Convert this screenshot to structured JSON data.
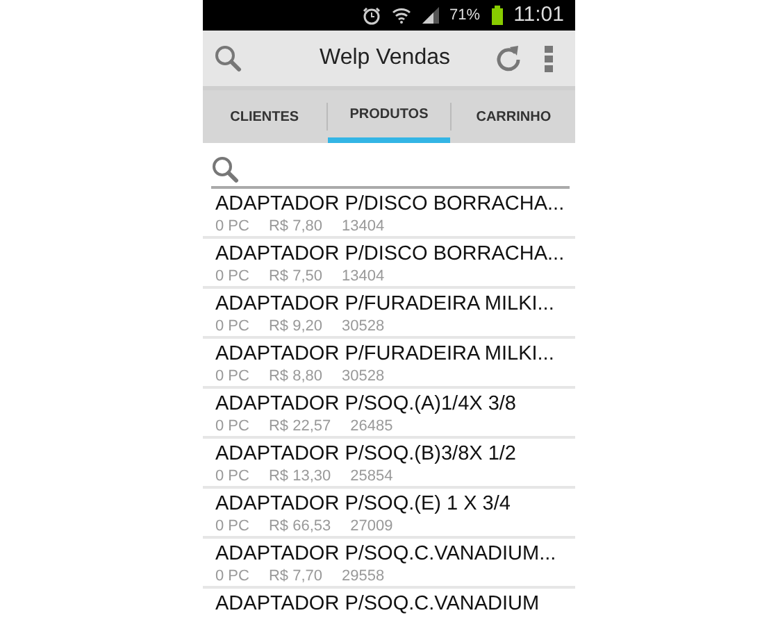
{
  "status_bar": {
    "battery_text": "71%",
    "time": "11:01"
  },
  "action_bar": {
    "title": "Welp Vendas"
  },
  "tabs": [
    {
      "label": "CLIENTES",
      "selected": false
    },
    {
      "label": "PRODUTOS",
      "selected": true
    },
    {
      "label": "CARRINHO",
      "selected": false
    }
  ],
  "products": [
    {
      "name": "ADAPTADOR P/DISCO BORRACHA...",
      "quantity": "0 PC",
      "price": "R$ 7,80",
      "code": "13404"
    },
    {
      "name": "ADAPTADOR P/DISCO BORRACHA...",
      "quantity": "0 PC",
      "price": "R$ 7,50",
      "code": "13404"
    },
    {
      "name": "ADAPTADOR P/FURADEIRA MILKI...",
      "quantity": "0 PC",
      "price": "R$ 9,20",
      "code": "30528"
    },
    {
      "name": "ADAPTADOR P/FURADEIRA MILKI...",
      "quantity": "0 PC",
      "price": "R$ 8,80",
      "code": "30528"
    },
    {
      "name": "ADAPTADOR P/SOQ.(A)1/4X 3/8",
      "quantity": "0 PC",
      "price": "R$ 22,57",
      "code": "26485"
    },
    {
      "name": "ADAPTADOR P/SOQ.(B)3/8X 1/2",
      "quantity": "0 PC",
      "price": "R$ 13,30",
      "code": "25854"
    },
    {
      "name": "ADAPTADOR P/SOQ.(E) 1 X 3/4",
      "quantity": "0 PC",
      "price": "R$ 66,53",
      "code": "27009"
    },
    {
      "name": "ADAPTADOR P/SOQ.C.VANADIUM...",
      "quantity": "0 PC",
      "price": "R$ 7,70",
      "code": "29558"
    },
    {
      "name": "ADAPTADOR P/SOQ.C.VANADIUM"
    }
  ]
}
